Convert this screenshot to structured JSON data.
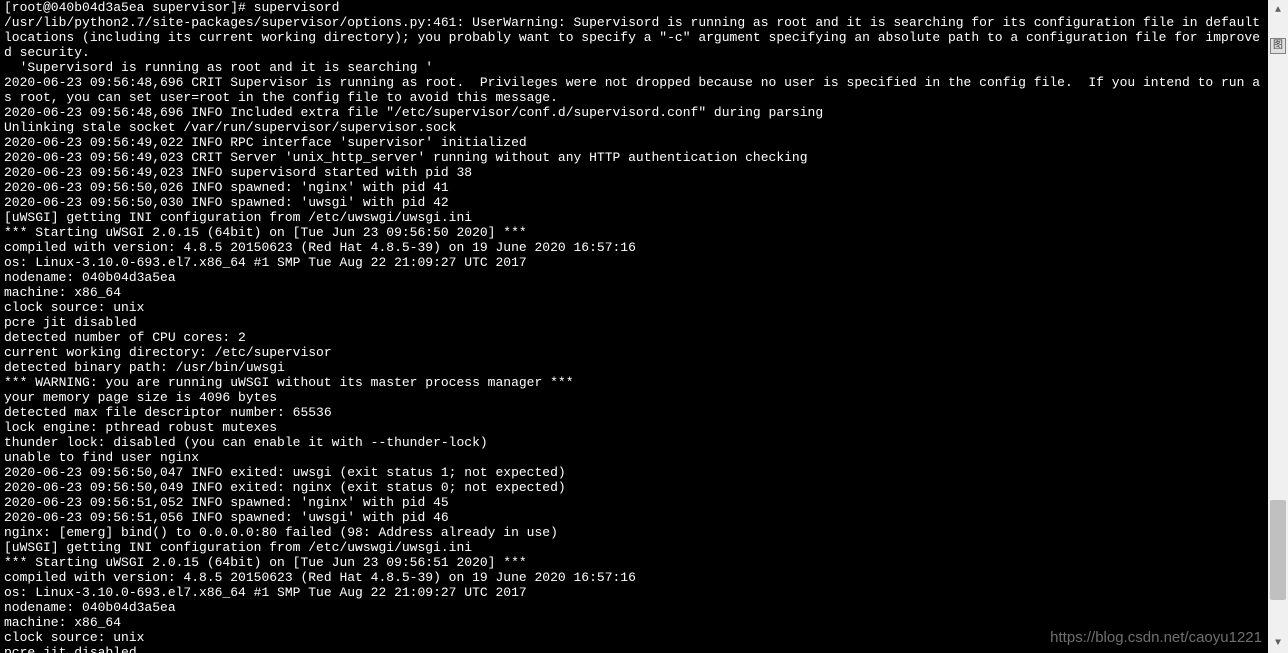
{
  "terminal": {
    "lines": [
      "[root@040b04d3a5ea supervisor]# supervisord",
      "/usr/lib/python2.7/site-packages/supervisor/options.py:461: UserWarning: Supervisord is running as root and it is searching for its configuration file in default locations (including its current working directory); you probably want to specify a \"-c\" argument specifying an absolute path to a configuration file for improved security.",
      "  'Supervisord is running as root and it is searching '",
      "2020-06-23 09:56:48,696 CRIT Supervisor is running as root.  Privileges were not dropped because no user is specified in the config file.  If you intend to run as root, you can set user=root in the config file to avoid this message.",
      "2020-06-23 09:56:48,696 INFO Included extra file \"/etc/supervisor/conf.d/supervisord.conf\" during parsing",
      "Unlinking stale socket /var/run/supervisor/supervisor.sock",
      "2020-06-23 09:56:49,022 INFO RPC interface 'supervisor' initialized",
      "2020-06-23 09:56:49,023 CRIT Server 'unix_http_server' running without any HTTP authentication checking",
      "2020-06-23 09:56:49,023 INFO supervisord started with pid 38",
      "2020-06-23 09:56:50,026 INFO spawned: 'nginx' with pid 41",
      "2020-06-23 09:56:50,030 INFO spawned: 'uwsgi' with pid 42",
      "[uWSGI] getting INI configuration from /etc/uwswgi/uwsgi.ini",
      "*** Starting uWSGI 2.0.15 (64bit) on [Tue Jun 23 09:56:50 2020] ***",
      "compiled with version: 4.8.5 20150623 (Red Hat 4.8.5-39) on 19 June 2020 16:57:16",
      "os: Linux-3.10.0-693.el7.x86_64 #1 SMP Tue Aug 22 21:09:27 UTC 2017",
      "nodename: 040b04d3a5ea",
      "machine: x86_64",
      "clock source: unix",
      "pcre jit disabled",
      "detected number of CPU cores: 2",
      "current working directory: /etc/supervisor",
      "detected binary path: /usr/bin/uwsgi",
      "*** WARNING: you are running uWSGI without its master process manager ***",
      "your memory page size is 4096 bytes",
      "detected max file descriptor number: 65536",
      "lock engine: pthread robust mutexes",
      "thunder lock: disabled (you can enable it with --thunder-lock)",
      "unable to find user nginx",
      "2020-06-23 09:56:50,047 INFO exited: uwsgi (exit status 1; not expected)",
      "2020-06-23 09:56:50,049 INFO exited: nginx (exit status 0; not expected)",
      "2020-06-23 09:56:51,052 INFO spawned: 'nginx' with pid 45",
      "2020-06-23 09:56:51,056 INFO spawned: 'uwsgi' with pid 46",
      "nginx: [emerg] bind() to 0.0.0.0:80 failed (98: Address already in use)",
      "[uWSGI] getting INI configuration from /etc/uwswgi/uwsgi.ini",
      "*** Starting uWSGI 2.0.15 (64bit) on [Tue Jun 23 09:56:51 2020] ***",
      "compiled with version: 4.8.5 20150623 (Red Hat 4.8.5-39) on 19 June 2020 16:57:16",
      "os: Linux-3.10.0-693.el7.x86_64 #1 SMP Tue Aug 22 21:09:27 UTC 2017",
      "nodename: 040b04d3a5ea",
      "machine: x86_64",
      "clock source: unix",
      "pcre jit disabled"
    ]
  },
  "scrollbar": {
    "up_glyph": "▲",
    "down_glyph": "▼"
  },
  "side_icon": {
    "label": "图"
  },
  "watermark": {
    "text": "https://blog.csdn.net/caoyu1221"
  }
}
